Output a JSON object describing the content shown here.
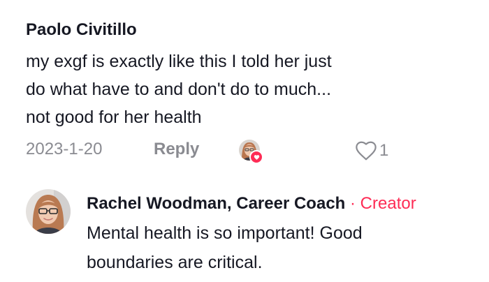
{
  "comment": {
    "author": "Paolo Civitillo",
    "text_lines": [
      "my exgf is exactly like this I told her just",
      "do what have to and don't do to much...",
      "not good for her health"
    ],
    "date": "2023-1-20",
    "reply_label": "Reply",
    "like_count": "1",
    "liked_by_creator_icon": "heart-icon"
  },
  "reply": {
    "author": "Rachel Woodman, Career Coach",
    "separator": "·",
    "badge": "Creator",
    "text_lines": [
      "Mental health is so important! Good",
      "boundaries are critical."
    ]
  },
  "colors": {
    "text": "#161823",
    "muted": "#8a8b91",
    "accent": "#fe2c55"
  }
}
